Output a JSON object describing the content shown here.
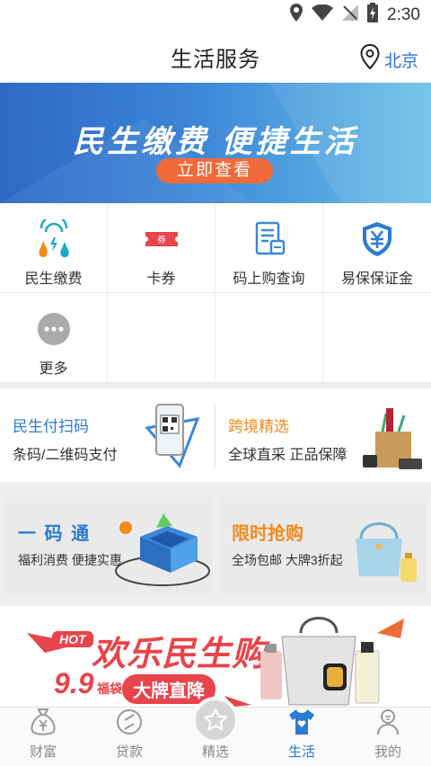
{
  "status_bar": {
    "time": "2:30"
  },
  "header": {
    "title": "生活服务",
    "location": "北京"
  },
  "banner": {
    "headline": "民生缴费  便捷生活",
    "button": "立即查看"
  },
  "services": [
    {
      "label": "民生缴费",
      "icon": "utilities-icon"
    },
    {
      "label": "卡券",
      "icon": "coupon-icon"
    },
    {
      "label": "码上购查询",
      "icon": "receipt-icon"
    },
    {
      "label": "易保保证金",
      "icon": "shield-yuan-icon"
    },
    {
      "label": "更多",
      "icon": "more-icon"
    }
  ],
  "promo_row1": [
    {
      "title": "民生付扫码",
      "subtitle": "条码/二维码支付"
    },
    {
      "title": "跨境精选",
      "subtitle": "全球直采 正品保障"
    }
  ],
  "promo_row2": [
    {
      "title": "一 码 通",
      "subtitle": "福利消费 便捷实惠"
    },
    {
      "title": "限时抢购",
      "subtitle": "全场包邮 大牌3折起"
    }
  ],
  "big_banner": {
    "hot": "HOT",
    "line1": "欢乐民生购",
    "price": "9.9",
    "bag": "福袋",
    "tag": "大牌直降"
  },
  "tabs": [
    {
      "label": "财富"
    },
    {
      "label": "贷款"
    },
    {
      "label": "精选"
    },
    {
      "label": "生活"
    },
    {
      "label": "我的"
    }
  ],
  "colors": {
    "brand_blue": "#2b7ad6",
    "orange": "#f28a1c",
    "banner_start": "#2e69c6",
    "banner_end": "#6bc2e8"
  }
}
